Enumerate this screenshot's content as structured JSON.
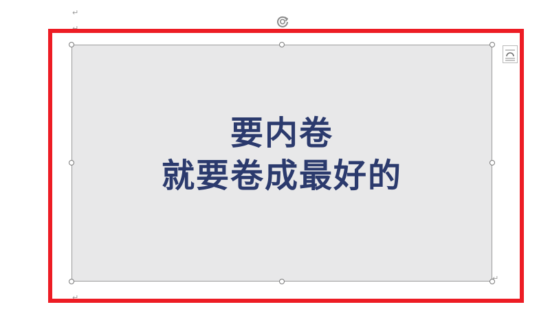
{
  "document": {
    "paragraph_mark": "↵"
  },
  "image": {
    "line1": "要内卷",
    "line2": "就要卷成最好的",
    "background_color": "#e8e8e9",
    "text_color": "#2b3a6d"
  },
  "highlight": {
    "color": "#ed1c24"
  },
  "icons": {
    "rotate": "rotate-handle-icon",
    "layout": "layout-options-icon"
  }
}
